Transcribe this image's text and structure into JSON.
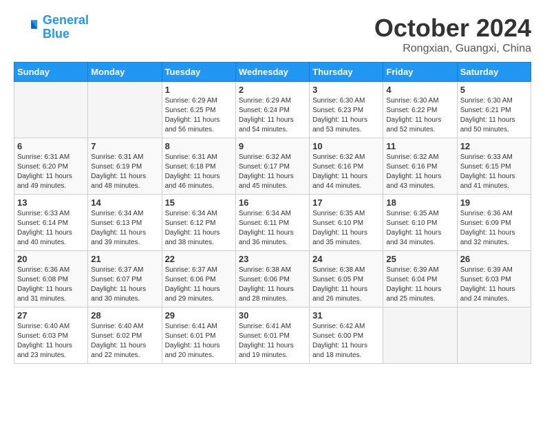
{
  "header": {
    "logo_general": "General",
    "logo_blue": "Blue",
    "month_title": "October 2024",
    "location": "Rongxian, Guangxi, China"
  },
  "weekdays": [
    "Sunday",
    "Monday",
    "Tuesday",
    "Wednesday",
    "Thursday",
    "Friday",
    "Saturday"
  ],
  "weeks": [
    [
      {
        "day": "",
        "info": ""
      },
      {
        "day": "",
        "info": ""
      },
      {
        "day": "1",
        "info": "Sunrise: 6:29 AM\nSunset: 6:25 PM\nDaylight: 11 hours and 56 minutes."
      },
      {
        "day": "2",
        "info": "Sunrise: 6:29 AM\nSunset: 6:24 PM\nDaylight: 11 hours and 54 minutes."
      },
      {
        "day": "3",
        "info": "Sunrise: 6:30 AM\nSunset: 6:23 PM\nDaylight: 11 hours and 53 minutes."
      },
      {
        "day": "4",
        "info": "Sunrise: 6:30 AM\nSunset: 6:22 PM\nDaylight: 11 hours and 52 minutes."
      },
      {
        "day": "5",
        "info": "Sunrise: 6:30 AM\nSunset: 6:21 PM\nDaylight: 11 hours and 50 minutes."
      }
    ],
    [
      {
        "day": "6",
        "info": "Sunrise: 6:31 AM\nSunset: 6:20 PM\nDaylight: 11 hours and 49 minutes."
      },
      {
        "day": "7",
        "info": "Sunrise: 6:31 AM\nSunset: 6:19 PM\nDaylight: 11 hours and 48 minutes."
      },
      {
        "day": "8",
        "info": "Sunrise: 6:31 AM\nSunset: 6:18 PM\nDaylight: 11 hours and 46 minutes."
      },
      {
        "day": "9",
        "info": "Sunrise: 6:32 AM\nSunset: 6:17 PM\nDaylight: 11 hours and 45 minutes."
      },
      {
        "day": "10",
        "info": "Sunrise: 6:32 AM\nSunset: 6:16 PM\nDaylight: 11 hours and 44 minutes."
      },
      {
        "day": "11",
        "info": "Sunrise: 6:32 AM\nSunset: 6:16 PM\nDaylight: 11 hours and 43 minutes."
      },
      {
        "day": "12",
        "info": "Sunrise: 6:33 AM\nSunset: 6:15 PM\nDaylight: 11 hours and 41 minutes."
      }
    ],
    [
      {
        "day": "13",
        "info": "Sunrise: 6:33 AM\nSunset: 6:14 PM\nDaylight: 11 hours and 40 minutes."
      },
      {
        "day": "14",
        "info": "Sunrise: 6:34 AM\nSunset: 6:13 PM\nDaylight: 11 hours and 39 minutes."
      },
      {
        "day": "15",
        "info": "Sunrise: 6:34 AM\nSunset: 6:12 PM\nDaylight: 11 hours and 38 minutes."
      },
      {
        "day": "16",
        "info": "Sunrise: 6:34 AM\nSunset: 6:11 PM\nDaylight: 11 hours and 36 minutes."
      },
      {
        "day": "17",
        "info": "Sunrise: 6:35 AM\nSunset: 6:10 PM\nDaylight: 11 hours and 35 minutes."
      },
      {
        "day": "18",
        "info": "Sunrise: 6:35 AM\nSunset: 6:10 PM\nDaylight: 11 hours and 34 minutes."
      },
      {
        "day": "19",
        "info": "Sunrise: 6:36 AM\nSunset: 6:09 PM\nDaylight: 11 hours and 32 minutes."
      }
    ],
    [
      {
        "day": "20",
        "info": "Sunrise: 6:36 AM\nSunset: 6:08 PM\nDaylight: 11 hours and 31 minutes."
      },
      {
        "day": "21",
        "info": "Sunrise: 6:37 AM\nSunset: 6:07 PM\nDaylight: 11 hours and 30 minutes."
      },
      {
        "day": "22",
        "info": "Sunrise: 6:37 AM\nSunset: 6:06 PM\nDaylight: 11 hours and 29 minutes."
      },
      {
        "day": "23",
        "info": "Sunrise: 6:38 AM\nSunset: 6:06 PM\nDaylight: 11 hours and 28 minutes."
      },
      {
        "day": "24",
        "info": "Sunrise: 6:38 AM\nSunset: 6:05 PM\nDaylight: 11 hours and 26 minutes."
      },
      {
        "day": "25",
        "info": "Sunrise: 6:39 AM\nSunset: 6:04 PM\nDaylight: 11 hours and 25 minutes."
      },
      {
        "day": "26",
        "info": "Sunrise: 6:39 AM\nSunset: 6:03 PM\nDaylight: 11 hours and 24 minutes."
      }
    ],
    [
      {
        "day": "27",
        "info": "Sunrise: 6:40 AM\nSunset: 6:03 PM\nDaylight: 11 hours and 23 minutes."
      },
      {
        "day": "28",
        "info": "Sunrise: 6:40 AM\nSunset: 6:02 PM\nDaylight: 11 hours and 22 minutes."
      },
      {
        "day": "29",
        "info": "Sunrise: 6:41 AM\nSunset: 6:01 PM\nDaylight: 11 hours and 20 minutes."
      },
      {
        "day": "30",
        "info": "Sunrise: 6:41 AM\nSunset: 6:01 PM\nDaylight: 11 hours and 19 minutes."
      },
      {
        "day": "31",
        "info": "Sunrise: 6:42 AM\nSunset: 6:00 PM\nDaylight: 11 hours and 18 minutes."
      },
      {
        "day": "",
        "info": ""
      },
      {
        "day": "",
        "info": ""
      }
    ]
  ]
}
